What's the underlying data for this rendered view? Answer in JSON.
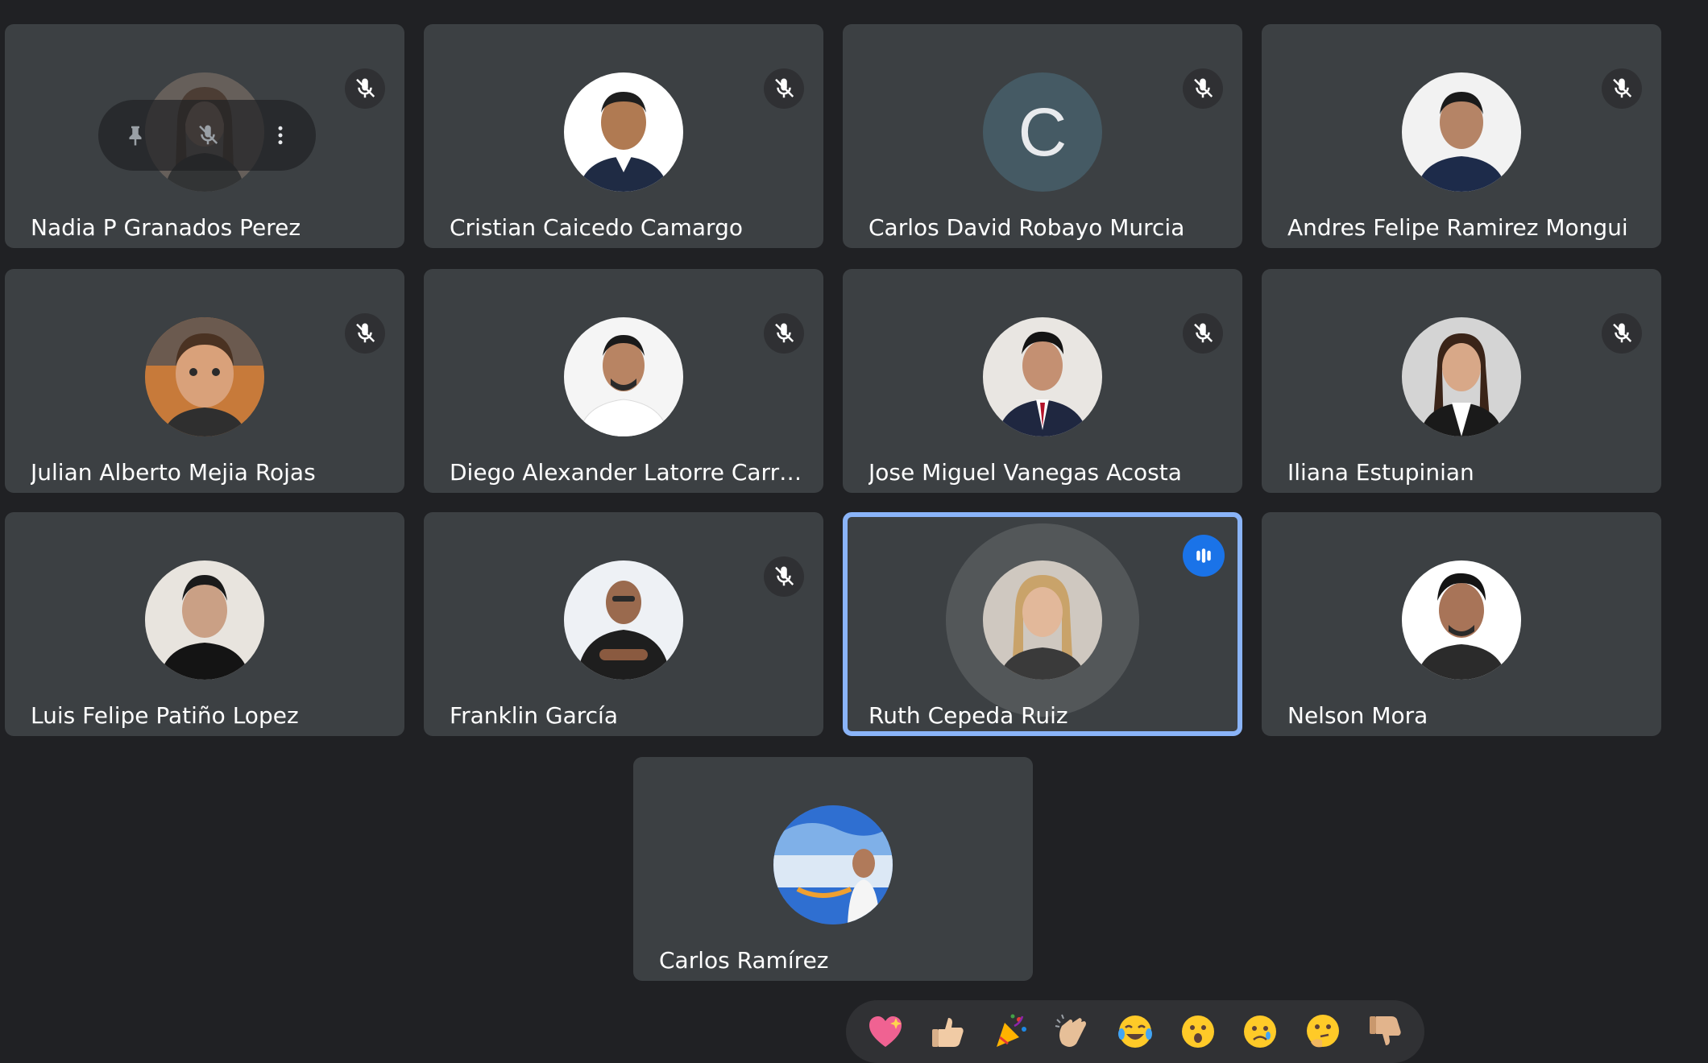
{
  "participants": [
    {
      "name": "Nadia P Granados Perez",
      "muted": true
    },
    {
      "name": "Cristian Caicedo Camargo",
      "muted": true
    },
    {
      "name": "Carlos David Robayo Murcia",
      "muted": true,
      "initial": "C"
    },
    {
      "name": "Andres Felipe Ramirez Mongui",
      "muted": true
    },
    {
      "name": "Julian Alberto Mejia Rojas",
      "muted": true
    },
    {
      "name": "Diego Alexander Latorre Carra...",
      "muted": true
    },
    {
      "name": "Jose Miguel Vanegas Acosta",
      "muted": true
    },
    {
      "name": "Iliana Estupinian",
      "muted": true
    },
    {
      "name": "Luis Felipe Patiño Lopez",
      "muted": false
    },
    {
      "name": "Franklin García",
      "muted": true
    },
    {
      "name": "Ruth Cepeda Ruiz",
      "muted": false,
      "speaking": true
    },
    {
      "name": "Nelson Mora",
      "muted": false
    },
    {
      "name": "Carlos Ramírez",
      "muted": false
    }
  ],
  "hover_controls": [
    "pin-icon",
    "mic-off-icon",
    "more-vert-icon"
  ],
  "icons": {
    "muted": "mic-off-icon",
    "speaking": "audio-level-icon"
  },
  "reactions": [
    "sparkling-heart",
    "thumbs-up",
    "party-popper",
    "clapping-hands",
    "tears-of-joy",
    "surprised",
    "crying",
    "thinking",
    "thumbs-down"
  ],
  "colors": {
    "background": "#202124",
    "tile": "#3c4043",
    "speaking_border": "#8ab4f8",
    "speaking_badge": "#1a73e8"
  }
}
